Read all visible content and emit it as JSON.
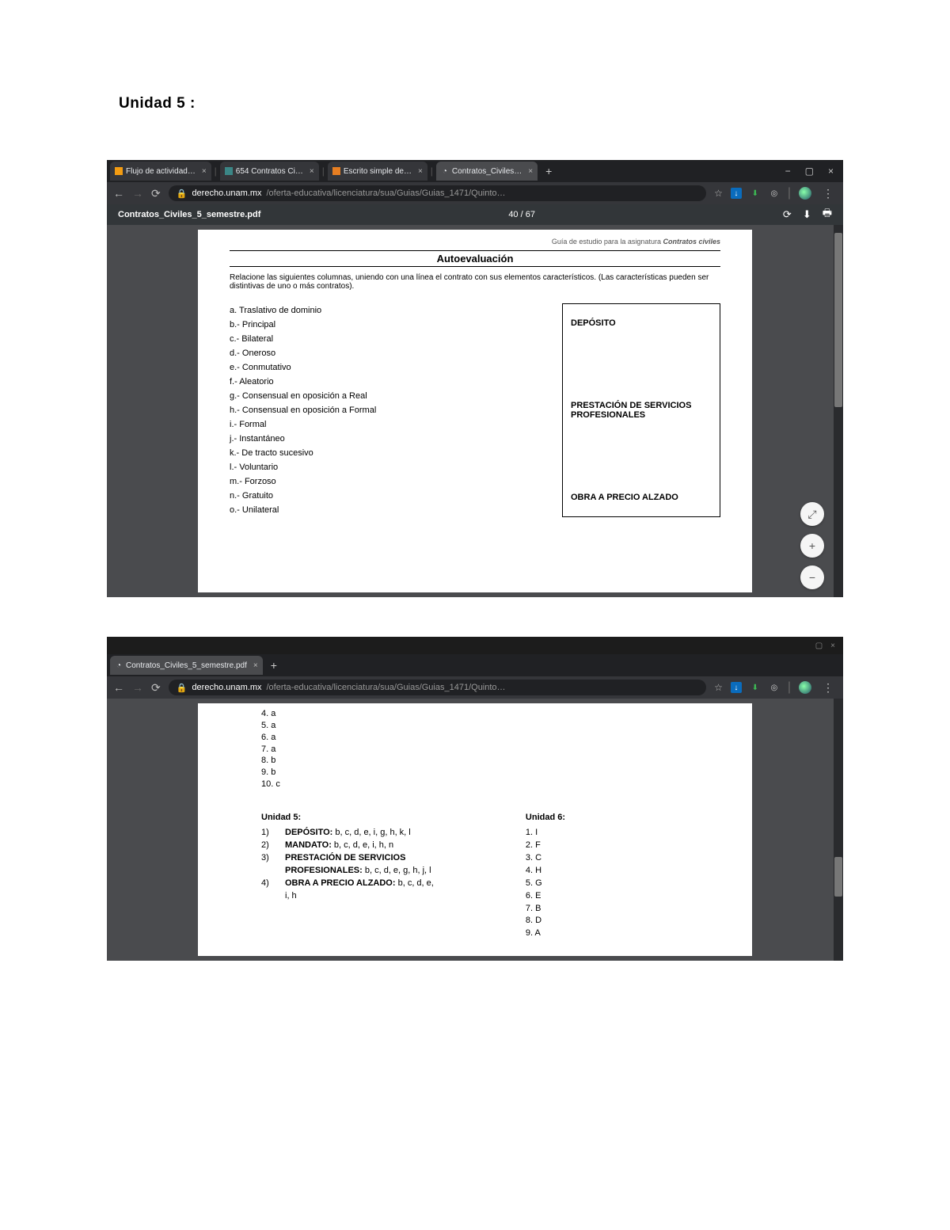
{
  "page": {
    "title": "Unidad 5 :"
  },
  "b1": {
    "tabs": [
      {
        "label": "Flujo de actividad…",
        "favicon_color": "#f39c12"
      },
      {
        "label": "654 Contratos Ci…",
        "favicon_color": "#3b8686"
      },
      {
        "label": "Escrito simple de…",
        "favicon_color": "#e67e22"
      },
      {
        "label": "Contratos_Civiles…",
        "favicon_color": "#888"
      }
    ],
    "url_domain": "derecho.unam.mx",
    "url_path": "/oferta-educativa/licenciatura/sua/Guias/Guias_1471/Quinto…",
    "pdf_title": "Contratos_Civiles_5_semestre.pdf",
    "pdf_page": "40 / 67"
  },
  "doc1": {
    "header_pre": "Guía de estudio para la asignatura",
    "header_em": "Contratos civiles",
    "title": "Autoevaluación",
    "instr": "Relacione las siguientes columnas, uniendo con una línea el contrato con sus elementos característicos. (Las características pueden ser distintivas de uno o más contratos).",
    "items": [
      "a.   Traslativo de dominio",
      "b.- Principal",
      "c.- Bilateral",
      "d.- Oneroso",
      "e.- Conmutativo",
      "f.- Aleatorio",
      "g.- Consensual en oposición a Real",
      "h.- Consensual en oposición a Formal",
      "i.- Formal",
      "j.- Instantáneo",
      "k.- De tracto sucesivo",
      "l.- Voluntario",
      "m.- Forzoso",
      "n.- Gratuito",
      "o.- Unilateral"
    ],
    "box": {
      "a": "DEPÓSITO",
      "b": "PRESTACIÓN DE SERVICIOS PROFESIONALES",
      "c": "OBRA A PRECIO ALZADO"
    }
  },
  "b2": {
    "tab_label": "Contratos_Civiles_5_semestre.pdf",
    "url_domain": "derecho.unam.mx",
    "url_path": "/oferta-educativa/licenciatura/sua/Guias/Guias_1471/Quinto…"
  },
  "doc2": {
    "prev": [
      "4. a",
      "5. a",
      "6. a",
      "7. a",
      "8. b",
      "9. b",
      "10. c"
    ],
    "u5_title": "Unidad 5:",
    "u5": [
      {
        "n": "1)",
        "bold": "DEPÓSITO:",
        "rest": " b, c, d, e, i, g, h, k, l"
      },
      {
        "n": "2)",
        "bold": "MANDATO:",
        "rest": " b, c, d, e, i, h, n"
      },
      {
        "n": "3)",
        "bold": "PRESTACIÓN DE SERVICIOS",
        "rest": ""
      },
      {
        "n": "",
        "bold": "PROFESIONALES:",
        "rest": " b, c, d, e, g, h, j, l"
      },
      {
        "n": "4)",
        "bold": "OBRA A PRECIO ALZADO:",
        "rest": " b, c, d, e,"
      },
      {
        "n": "",
        "bold": "",
        "rest": "i, h"
      }
    ],
    "u6_title": "Unidad 6:",
    "u6": [
      "1. I",
      "2. F",
      "3. C",
      "4. H",
      "5. G",
      "6. E",
      "7. B",
      "8. D",
      "9. A"
    ]
  }
}
